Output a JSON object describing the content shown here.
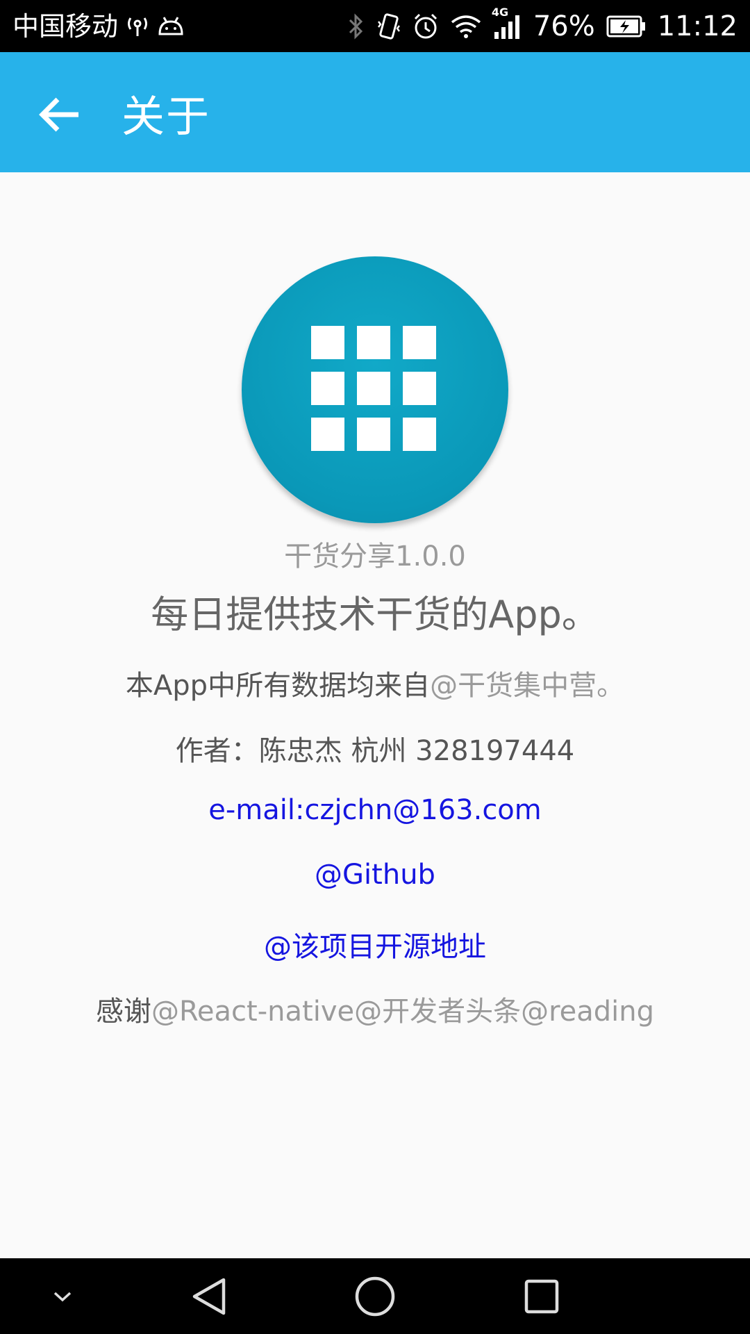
{
  "status_bar": {
    "carrier": "中国移动",
    "network": "4G",
    "battery": "76%",
    "time": "11:12",
    "icons": [
      "hotspot-icon",
      "android-icon",
      "bluetooth-icon",
      "vibrate-icon",
      "alarm-icon",
      "wifi-icon",
      "signal-icon",
      "battery-icon"
    ]
  },
  "app_bar": {
    "title": "关于",
    "back_icon": "arrow-left-icon",
    "color": "#27b2ea"
  },
  "about": {
    "logo_icon": "grid-icon",
    "logo_color": "#0a98b8",
    "version": "干货分享1.0.0",
    "slogan": "每日提供技术干货的App。",
    "data_source_prefix": "本App中所有数据均来自",
    "data_source_link": "@干货集中营。",
    "author": "作者：陈忠杰 杭州 328197444",
    "email": "e-mail:czjchn@163.com",
    "github": "@Github",
    "repo": "@该项目开源地址",
    "thanks_prefix": "感谢",
    "thanks_list": "@React-native@开发者头条@reading",
    "link_color": "#1515e0"
  },
  "nav_bar": {
    "icons": [
      "chevron-down-icon",
      "back-triangle-icon",
      "home-circle-icon",
      "recents-square-icon"
    ]
  }
}
